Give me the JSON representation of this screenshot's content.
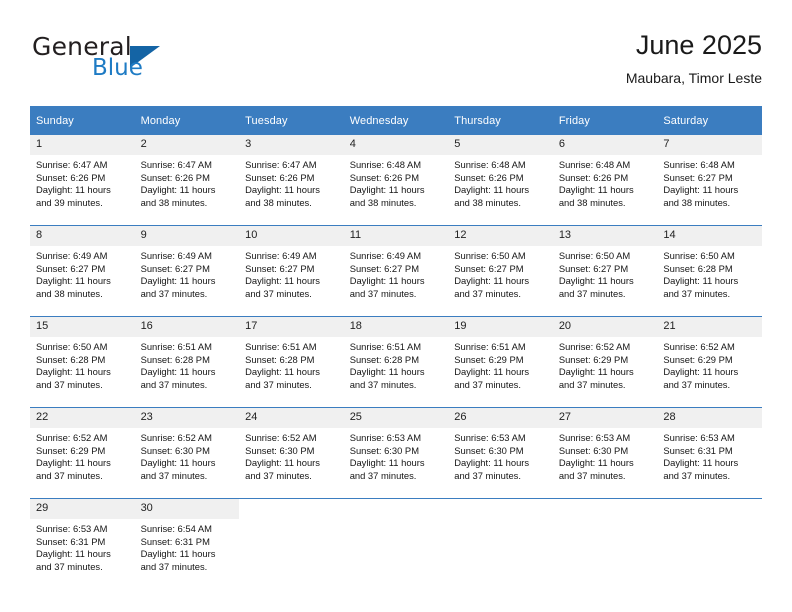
{
  "logo": {
    "word_top": "General",
    "word_bottom": "Blue",
    "triangle_color": "#1464a5",
    "blue_text_color": "#1e7bc4"
  },
  "header": {
    "title": "June 2025",
    "subtitle": "Maubara, Timor Leste"
  },
  "calendar": {
    "accent_color": "#3b7dc0",
    "daynum_band_color": "#f0f0f0",
    "weekday_headers": [
      "Sunday",
      "Monday",
      "Tuesday",
      "Wednesday",
      "Thursday",
      "Friday",
      "Saturday"
    ],
    "labels": {
      "sunrise_prefix": "Sunrise:",
      "sunset_prefix": "Sunset:",
      "daylight_prefix": "Daylight:"
    },
    "weeks": [
      [
        {
          "day": "1",
          "sunrise": "Sunrise: 6:47 AM",
          "sunset": "Sunset: 6:26 PM",
          "daylight_1": "Daylight: 11 hours",
          "daylight_2": "and 39 minutes."
        },
        {
          "day": "2",
          "sunrise": "Sunrise: 6:47 AM",
          "sunset": "Sunset: 6:26 PM",
          "daylight_1": "Daylight: 11 hours",
          "daylight_2": "and 38 minutes."
        },
        {
          "day": "3",
          "sunrise": "Sunrise: 6:47 AM",
          "sunset": "Sunset: 6:26 PM",
          "daylight_1": "Daylight: 11 hours",
          "daylight_2": "and 38 minutes."
        },
        {
          "day": "4",
          "sunrise": "Sunrise: 6:48 AM",
          "sunset": "Sunset: 6:26 PM",
          "daylight_1": "Daylight: 11 hours",
          "daylight_2": "and 38 minutes."
        },
        {
          "day": "5",
          "sunrise": "Sunrise: 6:48 AM",
          "sunset": "Sunset: 6:26 PM",
          "daylight_1": "Daylight: 11 hours",
          "daylight_2": "and 38 minutes."
        },
        {
          "day": "6",
          "sunrise": "Sunrise: 6:48 AM",
          "sunset": "Sunset: 6:26 PM",
          "daylight_1": "Daylight: 11 hours",
          "daylight_2": "and 38 minutes."
        },
        {
          "day": "7",
          "sunrise": "Sunrise: 6:48 AM",
          "sunset": "Sunset: 6:27 PM",
          "daylight_1": "Daylight: 11 hours",
          "daylight_2": "and 38 minutes."
        }
      ],
      [
        {
          "day": "8",
          "sunrise": "Sunrise: 6:49 AM",
          "sunset": "Sunset: 6:27 PM",
          "daylight_1": "Daylight: 11 hours",
          "daylight_2": "and 38 minutes."
        },
        {
          "day": "9",
          "sunrise": "Sunrise: 6:49 AM",
          "sunset": "Sunset: 6:27 PM",
          "daylight_1": "Daylight: 11 hours",
          "daylight_2": "and 37 minutes."
        },
        {
          "day": "10",
          "sunrise": "Sunrise: 6:49 AM",
          "sunset": "Sunset: 6:27 PM",
          "daylight_1": "Daylight: 11 hours",
          "daylight_2": "and 37 minutes."
        },
        {
          "day": "11",
          "sunrise": "Sunrise: 6:49 AM",
          "sunset": "Sunset: 6:27 PM",
          "daylight_1": "Daylight: 11 hours",
          "daylight_2": "and 37 minutes."
        },
        {
          "day": "12",
          "sunrise": "Sunrise: 6:50 AM",
          "sunset": "Sunset: 6:27 PM",
          "daylight_1": "Daylight: 11 hours",
          "daylight_2": "and 37 minutes."
        },
        {
          "day": "13",
          "sunrise": "Sunrise: 6:50 AM",
          "sunset": "Sunset: 6:27 PM",
          "daylight_1": "Daylight: 11 hours",
          "daylight_2": "and 37 minutes."
        },
        {
          "day": "14",
          "sunrise": "Sunrise: 6:50 AM",
          "sunset": "Sunset: 6:28 PM",
          "daylight_1": "Daylight: 11 hours",
          "daylight_2": "and 37 minutes."
        }
      ],
      [
        {
          "day": "15",
          "sunrise": "Sunrise: 6:50 AM",
          "sunset": "Sunset: 6:28 PM",
          "daylight_1": "Daylight: 11 hours",
          "daylight_2": "and 37 minutes."
        },
        {
          "day": "16",
          "sunrise": "Sunrise: 6:51 AM",
          "sunset": "Sunset: 6:28 PM",
          "daylight_1": "Daylight: 11 hours",
          "daylight_2": "and 37 minutes."
        },
        {
          "day": "17",
          "sunrise": "Sunrise: 6:51 AM",
          "sunset": "Sunset: 6:28 PM",
          "daylight_1": "Daylight: 11 hours",
          "daylight_2": "and 37 minutes."
        },
        {
          "day": "18",
          "sunrise": "Sunrise: 6:51 AM",
          "sunset": "Sunset: 6:28 PM",
          "daylight_1": "Daylight: 11 hours",
          "daylight_2": "and 37 minutes."
        },
        {
          "day": "19",
          "sunrise": "Sunrise: 6:51 AM",
          "sunset": "Sunset: 6:29 PM",
          "daylight_1": "Daylight: 11 hours",
          "daylight_2": "and 37 minutes."
        },
        {
          "day": "20",
          "sunrise": "Sunrise: 6:52 AM",
          "sunset": "Sunset: 6:29 PM",
          "daylight_1": "Daylight: 11 hours",
          "daylight_2": "and 37 minutes."
        },
        {
          "day": "21",
          "sunrise": "Sunrise: 6:52 AM",
          "sunset": "Sunset: 6:29 PM",
          "daylight_1": "Daylight: 11 hours",
          "daylight_2": "and 37 minutes."
        }
      ],
      [
        {
          "day": "22",
          "sunrise": "Sunrise: 6:52 AM",
          "sunset": "Sunset: 6:29 PM",
          "daylight_1": "Daylight: 11 hours",
          "daylight_2": "and 37 minutes."
        },
        {
          "day": "23",
          "sunrise": "Sunrise: 6:52 AM",
          "sunset": "Sunset: 6:30 PM",
          "daylight_1": "Daylight: 11 hours",
          "daylight_2": "and 37 minutes."
        },
        {
          "day": "24",
          "sunrise": "Sunrise: 6:52 AM",
          "sunset": "Sunset: 6:30 PM",
          "daylight_1": "Daylight: 11 hours",
          "daylight_2": "and 37 minutes."
        },
        {
          "day": "25",
          "sunrise": "Sunrise: 6:53 AM",
          "sunset": "Sunset: 6:30 PM",
          "daylight_1": "Daylight: 11 hours",
          "daylight_2": "and 37 minutes."
        },
        {
          "day": "26",
          "sunrise": "Sunrise: 6:53 AM",
          "sunset": "Sunset: 6:30 PM",
          "daylight_1": "Daylight: 11 hours",
          "daylight_2": "and 37 minutes."
        },
        {
          "day": "27",
          "sunrise": "Sunrise: 6:53 AM",
          "sunset": "Sunset: 6:30 PM",
          "daylight_1": "Daylight: 11 hours",
          "daylight_2": "and 37 minutes."
        },
        {
          "day": "28",
          "sunrise": "Sunrise: 6:53 AM",
          "sunset": "Sunset: 6:31 PM",
          "daylight_1": "Daylight: 11 hours",
          "daylight_2": "and 37 minutes."
        }
      ],
      [
        {
          "day": "29",
          "sunrise": "Sunrise: 6:53 AM",
          "sunset": "Sunset: 6:31 PM",
          "daylight_1": "Daylight: 11 hours",
          "daylight_2": "and 37 minutes."
        },
        {
          "day": "30",
          "sunrise": "Sunrise: 6:54 AM",
          "sunset": "Sunset: 6:31 PM",
          "daylight_1": "Daylight: 11 hours",
          "daylight_2": "and 37 minutes."
        },
        {
          "day": "",
          "sunrise": "",
          "sunset": "",
          "daylight_1": "",
          "daylight_2": ""
        },
        {
          "day": "",
          "sunrise": "",
          "sunset": "",
          "daylight_1": "",
          "daylight_2": ""
        },
        {
          "day": "",
          "sunrise": "",
          "sunset": "",
          "daylight_1": "",
          "daylight_2": ""
        },
        {
          "day": "",
          "sunrise": "",
          "sunset": "",
          "daylight_1": "",
          "daylight_2": ""
        },
        {
          "day": "",
          "sunrise": "",
          "sunset": "",
          "daylight_1": "",
          "daylight_2": ""
        }
      ]
    ]
  }
}
